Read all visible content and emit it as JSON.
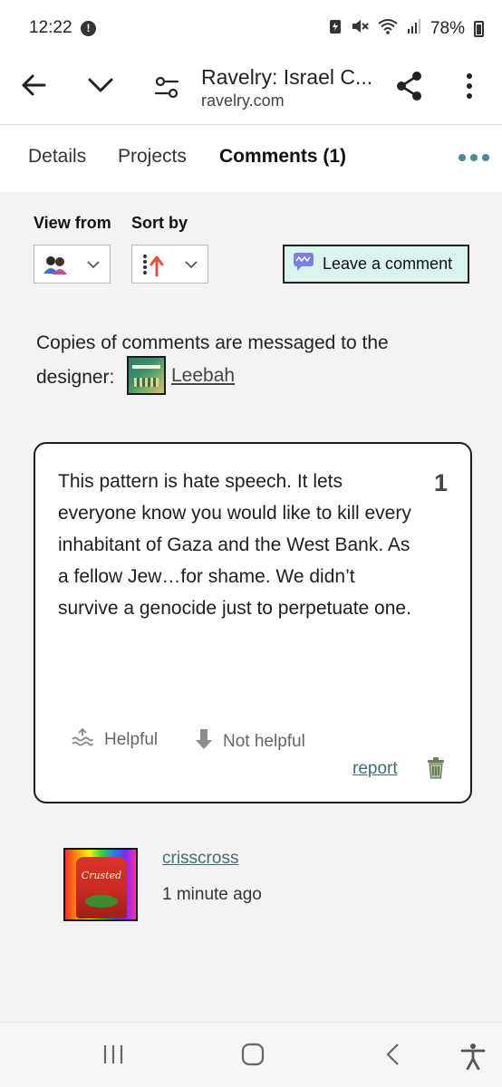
{
  "status_bar": {
    "time": "12:22",
    "battery": "78%",
    "icons": [
      "alert-icon",
      "battery-saver-icon",
      "mute-icon",
      "wifi-icon",
      "signal-icon",
      "battery-icon"
    ]
  },
  "browser": {
    "title": "Ravelry: Israel C...",
    "url": "ravelry.com",
    "icons": [
      "back-arrow-icon",
      "chevron-down-icon",
      "site-settings-icon",
      "share-icon",
      "overflow-menu-icon"
    ]
  },
  "tabs": [
    {
      "label": "Details",
      "active": false
    },
    {
      "label": "Projects",
      "active": false
    },
    {
      "label": "Comments (1)",
      "active": true
    }
  ],
  "controls": {
    "view_from_label": "View from",
    "sort_by_label": "Sort by",
    "leave_comment_label": "Leave a comment"
  },
  "designer_note": {
    "text": "Copies of comments are messaged to the designer:",
    "designer_name": "Leebah"
  },
  "comment": {
    "text": "This pattern is hate speech. It lets everyone know you would like to kill every inhabitant of Gaza and the West Bank. As a fellow Jew…for shame. We didn’t survive a genocide just to perpetuate one.",
    "number": "1",
    "helpful_label": "Helpful",
    "not_helpful_label": "Not helpful",
    "report_label": "report"
  },
  "author": {
    "username": "crisscross",
    "time_ago": "1 minute ago",
    "avatar_label": "Crusted"
  },
  "colors": {
    "accent": "#3d6e78",
    "button_bg": "#dbf3ef",
    "page_bg": "#f3f3f3"
  }
}
